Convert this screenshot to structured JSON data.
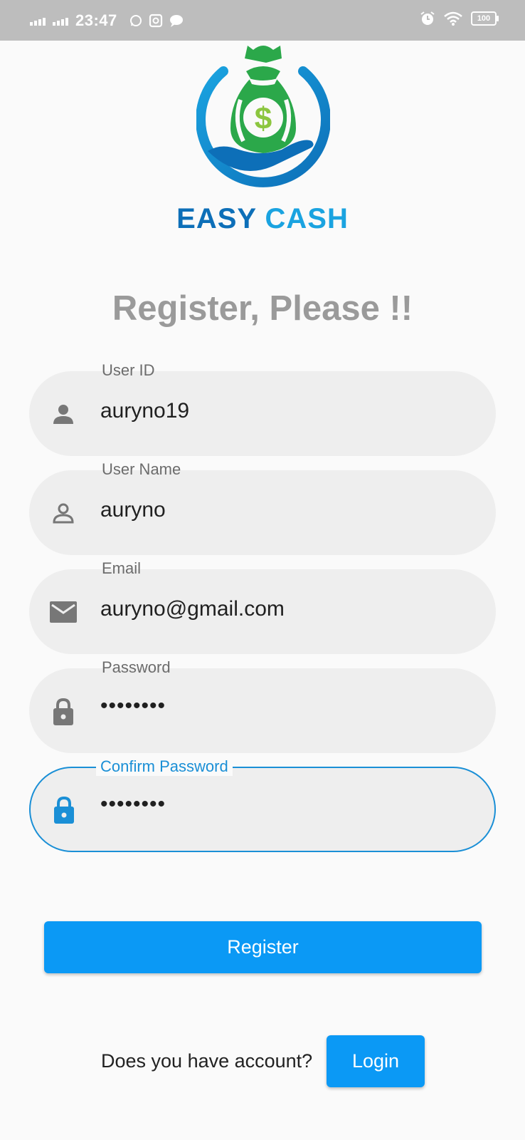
{
  "status_bar": {
    "time": "23:47",
    "battery": "100",
    "icons_left": [
      "signal-icon",
      "signal-icon",
      "whatsapp-icon",
      "instagram-icon",
      "chat-bubble-icon"
    ],
    "icons_right": [
      "alarm-icon",
      "wifi-icon",
      "battery-icon"
    ]
  },
  "brand": {
    "word1": "EASY",
    "word2": "CASH",
    "colors": {
      "dark_blue": "#0d6fb8",
      "light_blue": "#1aa3e0",
      "green": "#2ba84a"
    }
  },
  "page": {
    "title": "Register, Please !!"
  },
  "form": {
    "fields": [
      {
        "label": "User ID",
        "value": "auryno19",
        "icon": "person-icon"
      },
      {
        "label": "User Name",
        "value": "auryno",
        "icon": "person-outline-icon"
      },
      {
        "label": "Email",
        "value": "auryno@gmail.com",
        "icon": "mail-icon"
      },
      {
        "label": "Password",
        "value": "••••••••",
        "icon": "lock-icon"
      },
      {
        "label": "Confirm Password",
        "value": "••••••••",
        "icon": "lock-icon",
        "focused": true
      }
    ],
    "register_label": "Register"
  },
  "footer": {
    "question": "Does you have account?",
    "login_label": "Login"
  },
  "colors": {
    "accent": "#0b99f5",
    "focus": "#1a8fd6",
    "field_bg": "#eeeeee"
  }
}
